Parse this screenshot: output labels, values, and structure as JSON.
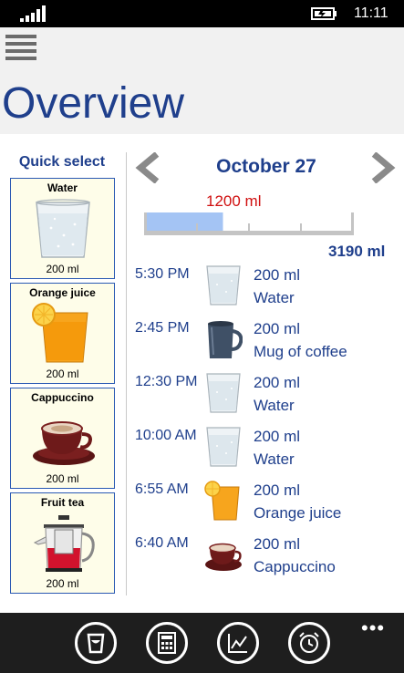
{
  "status_bar": {
    "time": "11:11"
  },
  "header": {
    "title": "Overview"
  },
  "quick_select": {
    "title": "Quick select",
    "items": [
      {
        "name": "Water",
        "amount": "200 ml",
        "icon": "water-glass-icon"
      },
      {
        "name": "Orange juice",
        "amount": "200 ml",
        "icon": "orange-juice-icon"
      },
      {
        "name": "Cappuccino",
        "amount": "200 ml",
        "icon": "cappuccino-icon"
      },
      {
        "name": "Fruit tea",
        "amount": "200 ml",
        "icon": "teapot-icon"
      }
    ]
  },
  "day": {
    "date": "October 27",
    "consumed": "1200 ml",
    "goal": "3190 ml",
    "progress_fraction": 0.376
  },
  "log": [
    {
      "time": "5:30 PM",
      "amount": "200 ml",
      "drink": "Water",
      "icon": "water-glass-icon"
    },
    {
      "time": "2:45 PM",
      "amount": "200 ml",
      "drink": "Mug of coffee",
      "icon": "coffee-mug-icon"
    },
    {
      "time": "12:30 PM",
      "amount": "200 ml",
      "drink": "Water",
      "icon": "water-glass-icon"
    },
    {
      "time": "10:00 AM",
      "amount": "200 ml",
      "drink": "Water",
      "icon": "water-glass-icon"
    },
    {
      "time": "6:55 AM",
      "amount": "200 ml",
      "drink": "Orange juice",
      "icon": "orange-juice-icon"
    },
    {
      "time": "6:40 AM",
      "amount": "200 ml",
      "drink": "Cappuccino",
      "icon": "cappuccino-icon"
    }
  ],
  "app_bar": {
    "buttons": [
      "drink-icon",
      "calculator-icon",
      "chart-icon",
      "alarm-icon"
    ],
    "more": "•••"
  },
  "colors": {
    "accent": "#1f3f8c",
    "current_amount": "#d01010",
    "progress_fill": "#a4c4f4",
    "card_bg": "#fefde9",
    "card_border": "#2a59b3"
  }
}
